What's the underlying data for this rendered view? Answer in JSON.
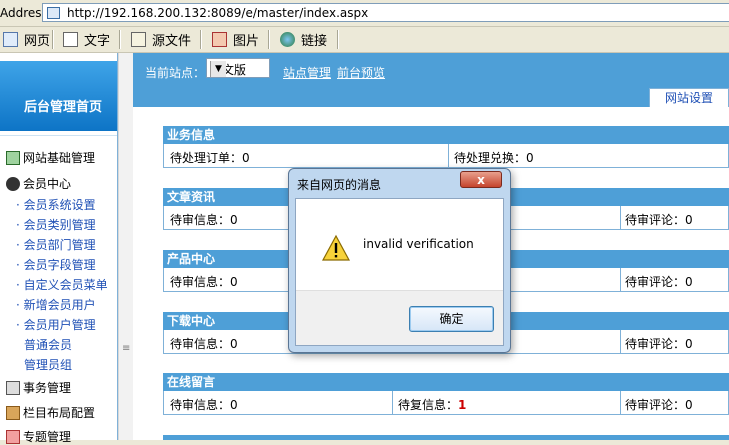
{
  "browser": {
    "address_label": "Address:",
    "url": "http://192.168.200.132:8089/e/master/index.aspx",
    "toolbar": [
      {
        "label": "网页",
        "icon": "web-page-icon"
      },
      {
        "label": "文字",
        "icon": "text-document-icon"
      },
      {
        "label": "源文件",
        "icon": "source-file-icon"
      },
      {
        "label": "图片",
        "icon": "picture-icon"
      },
      {
        "label": "链接",
        "icon": "link-globe-icon"
      }
    ]
  },
  "sidebar": {
    "title": "后台管理首页",
    "items": [
      {
        "label": "网站基础管理",
        "icon": "site-tree-icon"
      },
      {
        "label": "会员中心",
        "icon": "members-icon"
      },
      {
        "label": "事务管理",
        "icon": "tasks-icon"
      },
      {
        "label": "栏目布局配置",
        "icon": "tools-icon"
      },
      {
        "label": "专题管理",
        "icon": "topic-icon"
      }
    ],
    "member_sub": [
      "会员系统设置",
      "会员类别管理",
      "会员部门管理",
      "会员字段管理",
      "自定义会员菜单",
      "新增会员用户",
      "会员用户管理"
    ],
    "member_user_sub": [
      "普通会员",
      "管理员组"
    ]
  },
  "main": {
    "site_label": "当前站点：",
    "site_select": "中文版",
    "links": [
      "站点管理",
      "前台预览"
    ],
    "tab": "网站设置",
    "panels": [
      {
        "title": "业务信息",
        "cells": [
          "待处理订单：0",
          "待处理兑换：0",
          ""
        ]
      },
      {
        "title": "文章资讯",
        "cells": [
          "待审信息：0",
          "",
          "待审评论：0"
        ]
      },
      {
        "title": "产品中心",
        "cells": [
          "待审信息：0",
          "",
          "待审评论：0"
        ]
      },
      {
        "title": "下载中心",
        "cells": [
          "待审信息：0",
          "",
          "待审评论：0"
        ]
      },
      {
        "title": "在线留言",
        "cells": [
          "待审信息：0",
          "待复信息：",
          "待审评论：0"
        ],
        "reply_count": "1"
      }
    ]
  },
  "dialog": {
    "title": "来自网页的消息",
    "close": "x",
    "message": "invalid verification",
    "ok": "确定"
  }
}
